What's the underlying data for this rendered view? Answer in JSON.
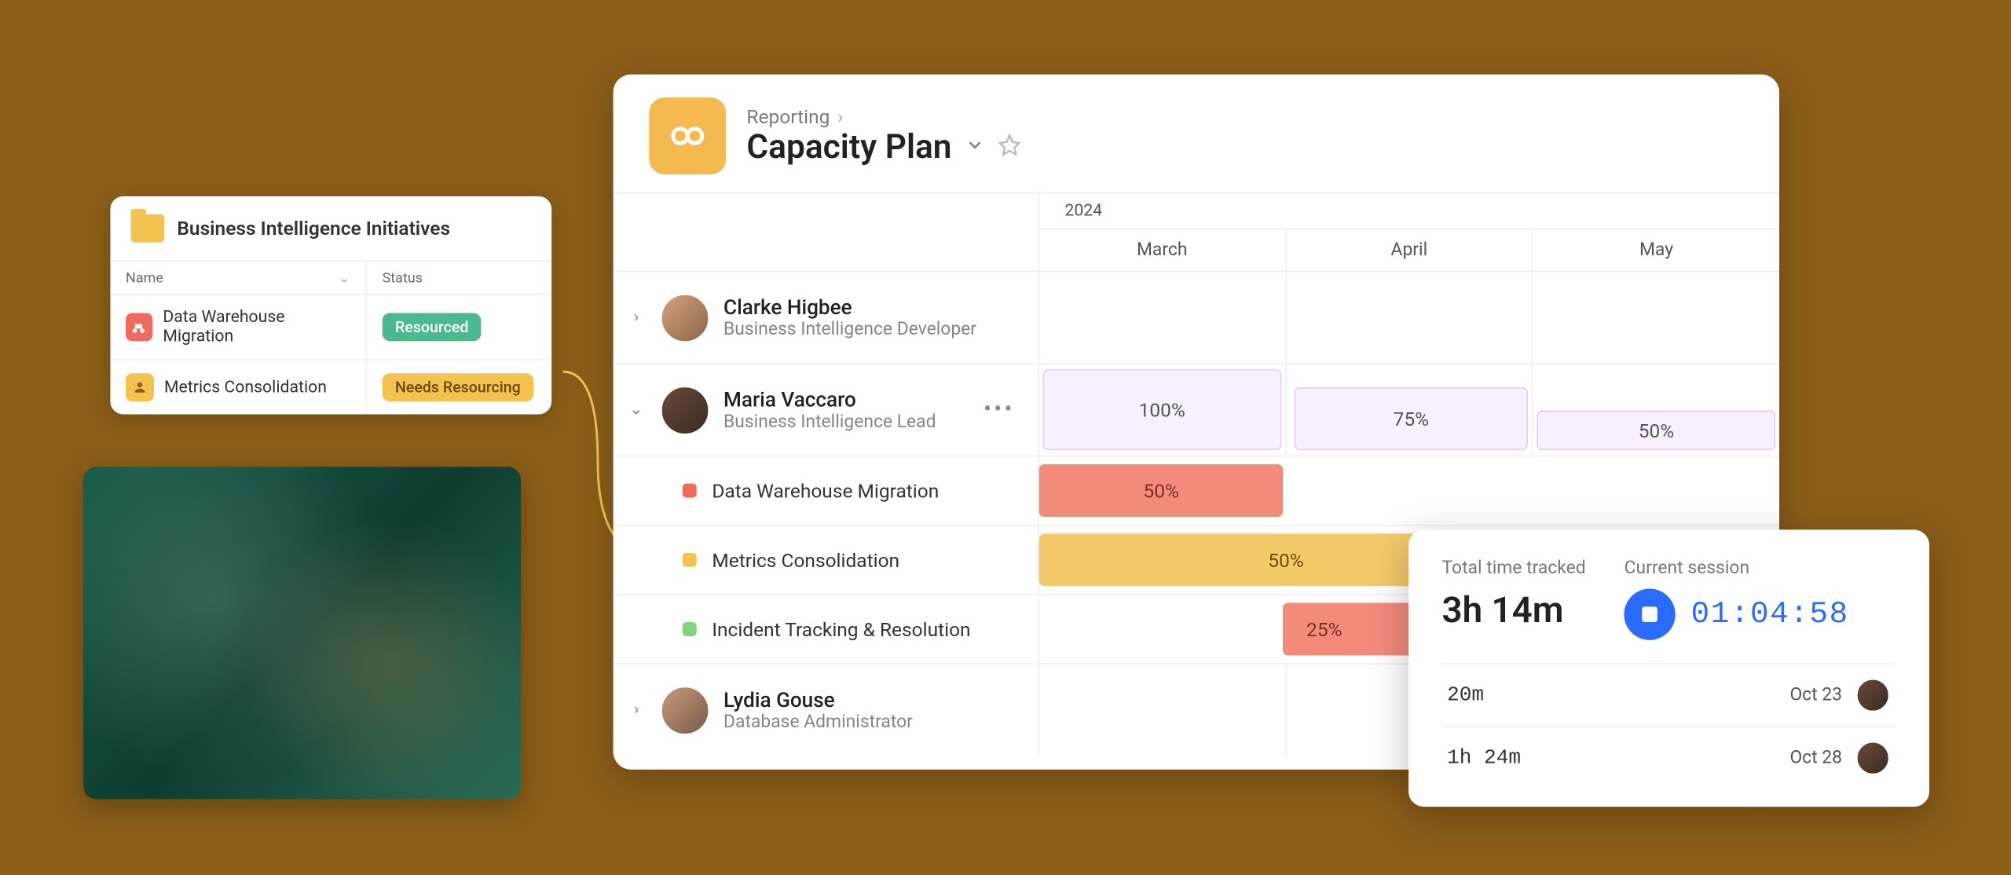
{
  "initiatives": {
    "title": "Business Intelligence Initiatives",
    "col_name": "Name",
    "col_status": "Status",
    "rows": [
      {
        "name": "Data Warehouse Migration",
        "status": "Resourced"
      },
      {
        "name": "Metrics Consolidation",
        "status": "Needs Resourcing"
      }
    ]
  },
  "main": {
    "breadcrumb": "Reporting",
    "title": "Capacity Plan",
    "year": "2024",
    "months": [
      "March",
      "April",
      "May"
    ],
    "people": [
      {
        "name": "Clarke Higbee",
        "role": "Business Intelligence Developer"
      },
      {
        "name": "Maria Vaccaro",
        "role": "Business Intelligence Lead",
        "alloc": [
          "100%",
          "75%",
          "50%"
        ],
        "tasks": [
          {
            "name": "Data Warehouse Migration",
            "pct": "50%"
          },
          {
            "name": "Metrics Consolidation",
            "pct": "50%"
          },
          {
            "name": "Incident Tracking & Resolution",
            "pct": "25%"
          }
        ]
      },
      {
        "name": "Lydia Gouse",
        "role": "Database Administrator"
      }
    ]
  },
  "tracker": {
    "total_label": "Total time tracked",
    "total_value": "3h 14m",
    "session_label": "Current session",
    "timer": "01:04:58",
    "entries": [
      {
        "duration": "20m",
        "date": "Oct 23"
      },
      {
        "duration": "1h 24m",
        "date": "Oct 28"
      }
    ]
  }
}
